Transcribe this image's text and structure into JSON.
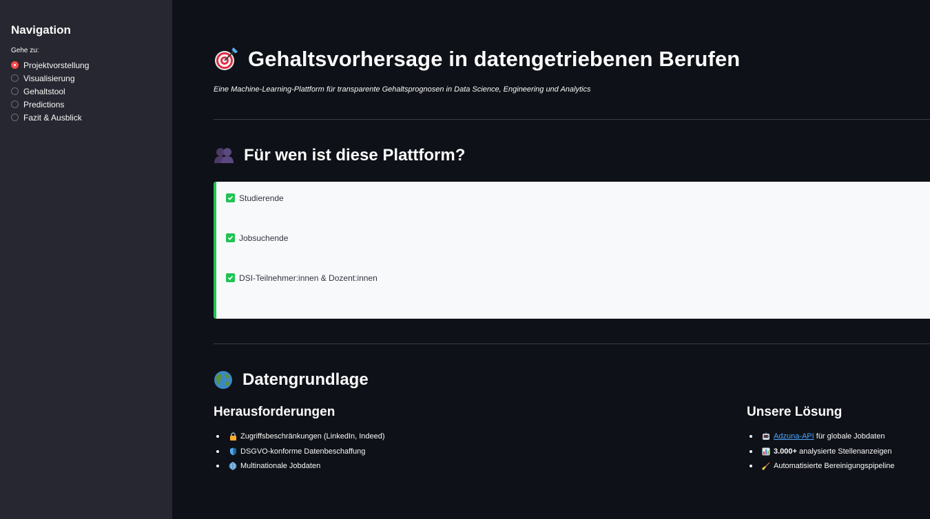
{
  "sidebar": {
    "title": "Navigation",
    "radio_label": "Gehe zu:",
    "items": [
      {
        "label": "Projektvorstellung",
        "selected": true
      },
      {
        "label": "Visualisierung",
        "selected": false
      },
      {
        "label": "Gehaltstool",
        "selected": false
      },
      {
        "label": "Predictions",
        "selected": false
      },
      {
        "label": "Fazit & Ausblick",
        "selected": false
      }
    ]
  },
  "header": {
    "title": "Gehaltsvorhersage in datengetriebenen Berufen",
    "icon": "target-icon",
    "subtitle": "Eine Machine-Learning-Plattform für transparente Gehaltsprognosen in Data Science, Engineering und Analytics"
  },
  "audience": {
    "title": "Für wen ist diese Plattform?",
    "icon": "people-icon",
    "items": [
      "Studierende",
      "Jobsuchende",
      "DSI-Teilnehmer:innen & Dozent:innen"
    ],
    "accent_color": "#21c354"
  },
  "data_basis": {
    "title": "Datengrundlage",
    "icon": "globe-icon",
    "challenges": {
      "title": "Herausforderungen",
      "items": [
        {
          "icon": "lock-icon",
          "text": "Zugriffsbeschränkungen (LinkedIn, Indeed)"
        },
        {
          "icon": "shield-icon",
          "text": "DSGVO-konforme Datenbeschaffung"
        },
        {
          "icon": "globe-grid-icon",
          "text": "Multinationale Jobdaten"
        }
      ]
    },
    "solution": {
      "title": "Unsere Lösung",
      "items": [
        {
          "icon": "robot-icon",
          "link": "Adzuna-API",
          "text": " für globale Jobdaten"
        },
        {
          "icon": "bar-chart-icon",
          "bold": "3.000+",
          "text": " analysierte Stellenanzeigen"
        },
        {
          "icon": "broom-icon",
          "text": "Automatisierte Bereinigungspipeline"
        }
      ]
    }
  },
  "colors": {
    "background": "#0e1117",
    "sidebar": "#262730",
    "radio_selected": "#ff4b4b",
    "link": "#4da6ff"
  }
}
